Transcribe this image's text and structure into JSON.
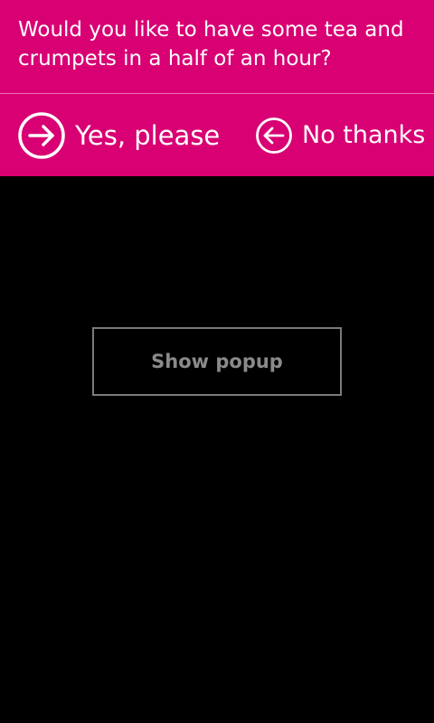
{
  "colors": {
    "accent": "#D80073",
    "background": "#000000",
    "button_border": "#7A7A7A",
    "button_text": "#8A8A8A"
  },
  "popup": {
    "message": "Would you like to have some tea and crumpets in a half of an hour?",
    "yes_action": {
      "label": "Yes, please",
      "icon": "arrow-right-circle-icon"
    },
    "no_action": {
      "label": "No thanks",
      "icon": "arrow-left-circle-icon"
    }
  },
  "main": {
    "show_popup_label": "Show popup"
  }
}
